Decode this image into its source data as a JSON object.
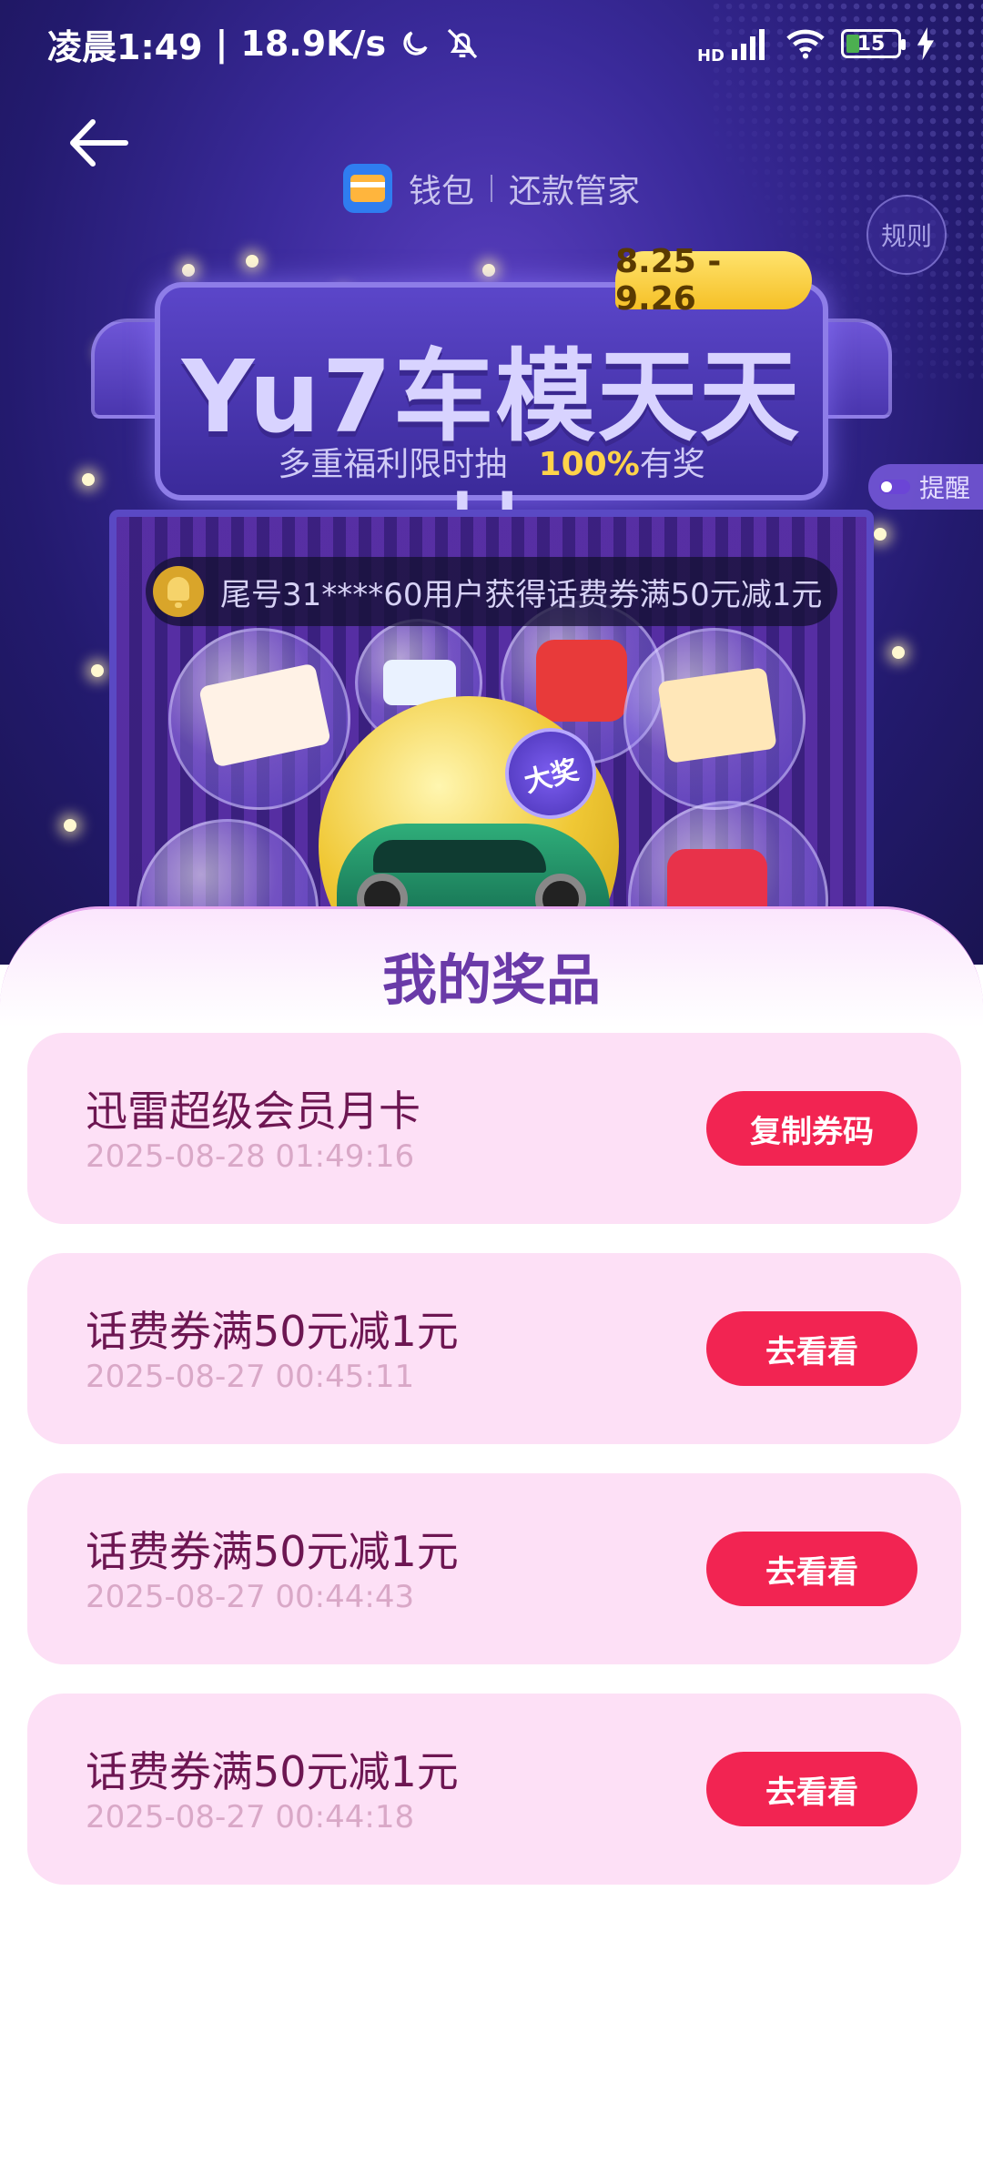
{
  "status_bar": {
    "time": "凌晨1:49",
    "speed": "18.9K/s",
    "network_label": "HD",
    "battery": "15",
    "icons": [
      "moon-icon",
      "bell-off-icon",
      "signal-icon",
      "wifi-icon",
      "battery-icon",
      "charging-icon"
    ]
  },
  "header": {
    "brand": "钱包",
    "section": "还款管家",
    "rule_label": "规则",
    "remind_label": "提醒"
  },
  "promo": {
    "date_range": "8.25 - 9.26",
    "title": "Yu7车模天天抽",
    "subtitle_prefix": "多重福利限时抽",
    "subtitle_highlight": "100%",
    "subtitle_suffix": "有奖",
    "ticker": "尾号31****60用户获得话费券满50元减1元",
    "big_prize_tag": "大奖"
  },
  "prizes_section": {
    "title": "我的奖品",
    "items": [
      {
        "name": "迅雷超级会员月卡",
        "time": "2025-08-28 01:49:16",
        "action": "复制券码"
      },
      {
        "name": "话费券满50元减1元",
        "time": "2025-08-27 00:45:11",
        "action": "去看看"
      },
      {
        "name": "话费券满50元减1元",
        "time": "2025-08-27 00:44:43",
        "action": "去看看"
      },
      {
        "name": "话费券满50元减1元",
        "time": "2025-08-27 00:44:18",
        "action": "去看看"
      }
    ]
  },
  "colors": {
    "banner_bg": "#2a1f80",
    "card_bg": "#fde0f6",
    "button_bg": "#f22452",
    "title_color": "#6a3aa8",
    "date_badge": "#f5c026"
  }
}
